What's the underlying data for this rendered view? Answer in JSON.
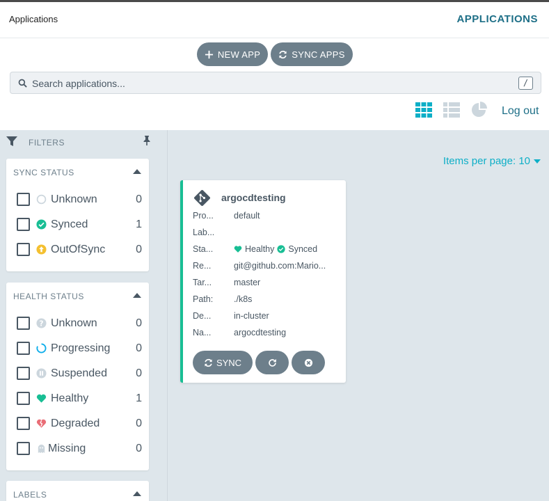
{
  "header": {
    "breadcrumb": "Applications",
    "page_title": "APPLICATIONS"
  },
  "toolbar": {
    "new_app_label": "NEW APP",
    "sync_apps_label": "SYNC APPS",
    "search_placeholder": "Search applications...",
    "search_shortcut": "/",
    "logout_label": "Log out",
    "view_modes": [
      "tiles-icon",
      "list-icon",
      "pie-chart-icon"
    ],
    "active_view": "tiles"
  },
  "sidebar": {
    "filters_label": "FILTERS",
    "sync_status": {
      "title": "SYNC STATUS",
      "items": [
        {
          "label": "Unknown",
          "count": "0",
          "icon": "circle-notch-icon"
        },
        {
          "label": "Synced",
          "count": "1",
          "icon": "check-circle-icon"
        },
        {
          "label": "OutOfSync",
          "count": "0",
          "icon": "arrow-up-circle-icon"
        }
      ]
    },
    "health_status": {
      "title": "HEALTH STATUS",
      "items": [
        {
          "label": "Unknown",
          "count": "0",
          "icon": "question-circle-icon"
        },
        {
          "label": "Progressing",
          "count": "0",
          "icon": "spinner-icon"
        },
        {
          "label": "Suspended",
          "count": "0",
          "icon": "pause-circle-icon"
        },
        {
          "label": "Healthy",
          "count": "1",
          "icon": "heart-icon"
        },
        {
          "label": "Degraded",
          "count": "0",
          "icon": "heart-broken-icon"
        },
        {
          "label": "Missing",
          "count": "0",
          "icon": "ghost-icon"
        }
      ]
    },
    "labels": {
      "title": "LABELS"
    }
  },
  "main": {
    "items_per_page": "Items per page: 10",
    "app_card": {
      "name": "argocdtesting",
      "fields": [
        {
          "key": "Pro...",
          "value": "default"
        },
        {
          "key": "Lab...",
          "value": ""
        },
        {
          "key": "Sta...",
          "health": "Healthy",
          "sync": "Synced"
        },
        {
          "key": "Re...",
          "value": "git@github.com:Mario..."
        },
        {
          "key": "Tar...",
          "value": "master"
        },
        {
          "key": "Path:",
          "value": "./k8s"
        },
        {
          "key": "De...",
          "value": "in-cluster"
        },
        {
          "key": "Na...",
          "value": "argocdtesting"
        }
      ],
      "sync_button": "SYNC"
    }
  },
  "colors": {
    "accent": "#1e6f87",
    "button": "#6d7f8b",
    "healthy": "#18be94",
    "out_of_sync": "#f4c030",
    "degraded": "#e96d76",
    "items_per_page": "#0eafc7",
    "sidebar_bg": "#dee6eb"
  }
}
